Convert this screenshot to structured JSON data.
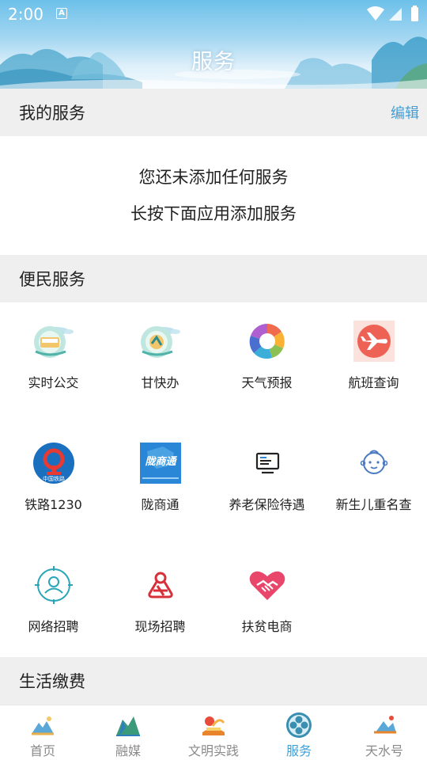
{
  "status_bar": {
    "time": "2:00",
    "a_badge": "A"
  },
  "header": {
    "title": "服务"
  },
  "my_services": {
    "title": "我的服务",
    "edit_label": "编辑",
    "empty_line1": "您还未添加任何服务",
    "empty_line2": "长按下面应用添加服务"
  },
  "convenience": {
    "title": "便民服务",
    "items": [
      {
        "label": "实时公交",
        "icon": "bus-icon"
      },
      {
        "label": "甘快办",
        "icon": "gankuaiban-icon"
      },
      {
        "label": "天气预报",
        "icon": "weather-icon"
      },
      {
        "label": "航班查询",
        "icon": "airplane-icon"
      },
      {
        "label": "铁路1230",
        "icon": "railway-icon",
        "icon_text": "中国铁路"
      },
      {
        "label": "陇商通",
        "icon": "longshangtong-icon",
        "icon_text": "陇商通"
      },
      {
        "label": "养老保险待遇",
        "icon": "monitor-icon"
      },
      {
        "label": "新生儿重名查",
        "icon": "baby-icon"
      },
      {
        "label": "网络招聘",
        "icon": "user-circle-icon"
      },
      {
        "label": "现场招聘",
        "icon": "job-logo-icon"
      },
      {
        "label": "扶贫电商",
        "icon": "heart-handshake-icon"
      }
    ]
  },
  "life_payment": {
    "title": "生活缴费"
  },
  "bottom_nav": {
    "items": [
      {
        "label": "首页",
        "icon": "home-icon"
      },
      {
        "label": "融媒",
        "icon": "media-icon"
      },
      {
        "label": "文明实践",
        "icon": "civilization-icon"
      },
      {
        "label": "服务",
        "icon": "service-icon",
        "active": true
      },
      {
        "label": "天水号",
        "icon": "tianshui-icon"
      }
    ]
  },
  "colors": {
    "accent": "#3fa0d8",
    "section_bg": "#efefef",
    "text": "#222222"
  }
}
